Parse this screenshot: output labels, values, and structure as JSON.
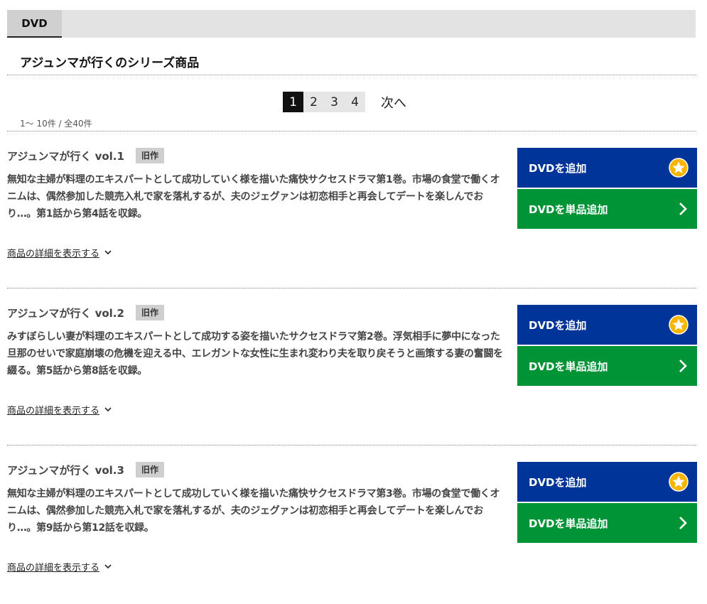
{
  "tab": {
    "label": "DVD"
  },
  "series_title": "アジュンマが行くのシリーズ商品",
  "pagination": {
    "pages": [
      "1",
      "2",
      "3",
      "4"
    ],
    "current": "1",
    "next_label": "次へ",
    "range_text": "1～ 10件 / 全40件"
  },
  "items": [
    {
      "title": "アジュンマが行く vol.1",
      "badge": "旧作",
      "description": "無知な主婦が料理のエキスパートとして成功していく様を描いた痛快サクセスドラマ第1巻。市場の食堂で働くオニムは、偶然参加した競売入札で家を落札するが、夫のジェグァンは初恋相手と再会してデートを楽しんでおり…。第1話から第4話を収録。",
      "detail_link": "商品の詳細を表示する",
      "add_button": "DVDを追加",
      "single_button": "DVDを単品追加"
    },
    {
      "title": "アジュンマが行く vol.2",
      "badge": "旧作",
      "description": "みすぼらしい妻が料理のエキスパートとして成功する姿を描いたサクセスドラマ第2巻。浮気相手に夢中になった旦那のせいで家庭崩壊の危機を迎える中、エレガントな女性に生まれ変わり夫を取り戻そうと画策する妻の奮闘を綴る。第5話から第8話を収録。",
      "detail_link": "商品の詳細を表示する",
      "add_button": "DVDを追加",
      "single_button": "DVDを単品追加"
    },
    {
      "title": "アジュンマが行く vol.3",
      "badge": "旧作",
      "description": "無知な主婦が料理のエキスパートとして成功していく様を描いた痛快サクセスドラマ第3巻。市場の食堂で働くオニムは、偶然参加した競売入札で家を落札するが、夫のジェグァンは初恋相手と再会してデートを楽しんでおり…。第9話から第12話を収録。",
      "detail_link": "商品の詳細を表示する",
      "add_button": "DVDを追加",
      "single_button": "DVDを単品追加"
    }
  ],
  "colors": {
    "add_button_bg": "#003499",
    "single_button_bg": "#009436",
    "star_fill": "#f7b500"
  },
  "icons": {
    "add_button_icon": "star-icon",
    "single_button_icon": "chevron-right-icon",
    "detail_link_icon": "chevron-down-icon"
  }
}
